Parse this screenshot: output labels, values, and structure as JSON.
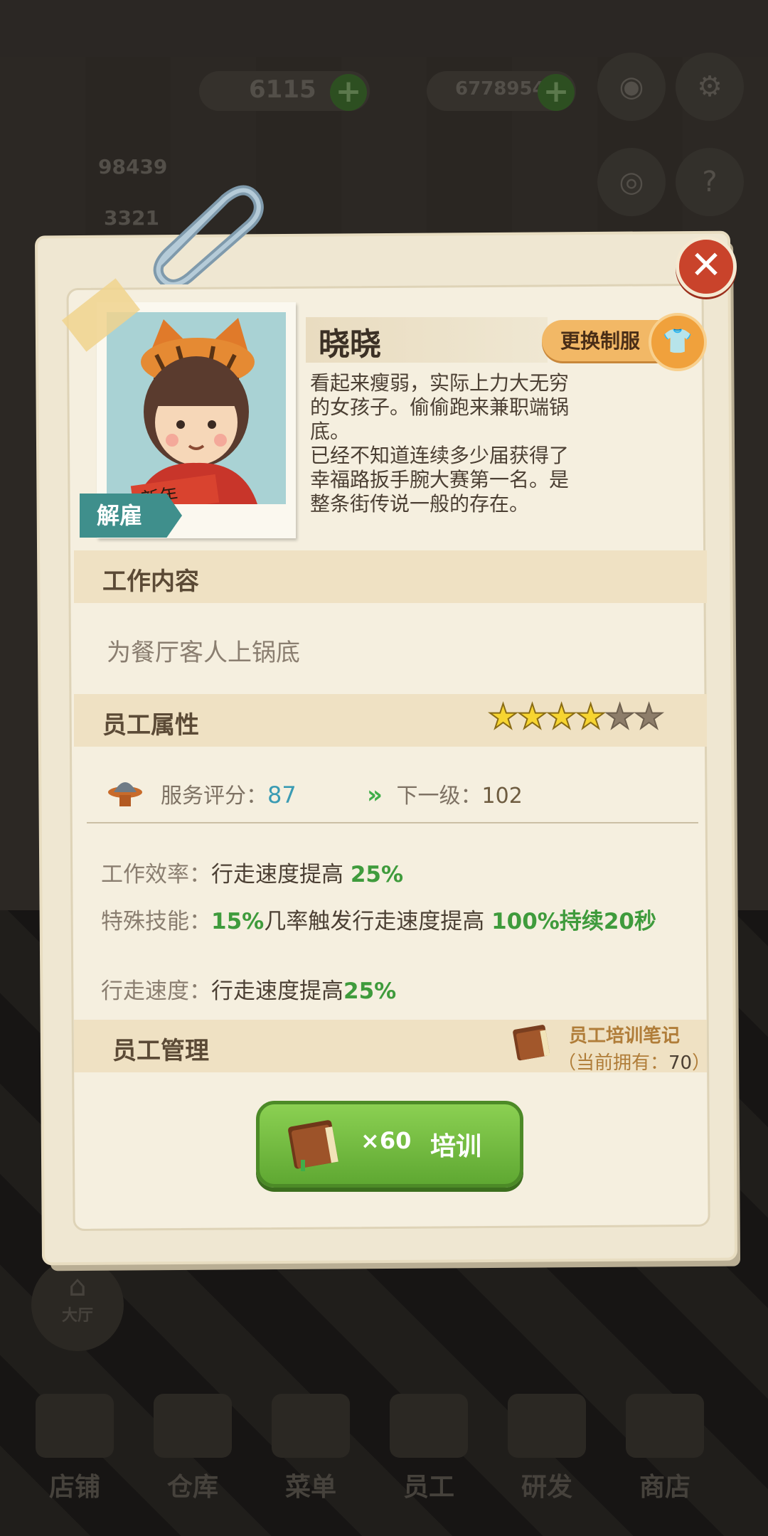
{
  "top_bar": {
    "coins": "6115",
    "cash": "67789546",
    "stat1": "98439",
    "stat2": "3321"
  },
  "hall_button": {
    "label": "大厅"
  },
  "bottom_nav": {
    "items": [
      {
        "label": "店铺",
        "icon": "shop-icon"
      },
      {
        "label": "仓库",
        "icon": "warehouse-icon"
      },
      {
        "label": "菜单",
        "icon": "menu-icon"
      },
      {
        "label": "员工",
        "icon": "staff-icon"
      },
      {
        "label": "研发",
        "icon": "research-icon"
      },
      {
        "label": "商店",
        "icon": "store-icon"
      }
    ]
  },
  "dialog": {
    "name": "晓晓",
    "change_uniform_label": "更换制服",
    "dismiss_label": "解雇",
    "description": "看起来瘦弱，实际上力大无穷\n的女孩子。偷偷跑来兼职端锅\n底。\n已经不知道连续多少届获得了\n幸福路扳手腕大赛第一名。是\n整条街传说一般的存在。",
    "work_section": {
      "title": "工作内容",
      "text": "为餐厅客人上锅底"
    },
    "attributes_section": {
      "title": "员工属性",
      "stars_filled": 4,
      "stars_total": 6,
      "service_score_label": "服务评分：",
      "service_score_value": "87",
      "next_level_label": "下一级：",
      "next_level_value": "102",
      "efficiency_label": "工作效率：",
      "efficiency_text": "行走速度提高",
      "efficiency_value": "25%",
      "skill_label": "特殊技能：",
      "skill_pct": "15%",
      "skill_text": "几率触发行走速度提高",
      "skill_value": "100%持续20秒",
      "speed_label": "行走速度：",
      "speed_text": "行走速度提高",
      "speed_value": "25%"
    },
    "management_section": {
      "title": "员工管理",
      "notes_label": "员工培训笔记",
      "owned_prefix": "（当前拥有：",
      "owned_value": "70",
      "owned_suffix": "）"
    },
    "train_button": {
      "cost": "×60",
      "label": "培训"
    }
  },
  "colors": {
    "accent_green": "#5fa832",
    "close_red": "#c9432b",
    "score_blue": "#3a9bb3",
    "star_yellow": "#f7d531"
  }
}
